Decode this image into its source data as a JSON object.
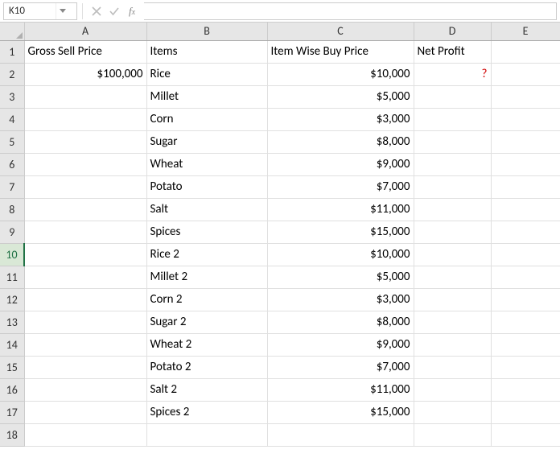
{
  "namebox": {
    "value": "K10"
  },
  "formula": {
    "value": ""
  },
  "columns": [
    "A",
    "B",
    "C",
    "D",
    "E"
  ],
  "active_row": 10,
  "header": {
    "A": "Gross Sell Price",
    "B": "Items",
    "C": "Item Wise Buy Price",
    "D": "Net Profit",
    "E": ""
  },
  "row2": {
    "A": "$100,000",
    "D": "?"
  },
  "rows": [
    {
      "n": 2,
      "B": "Rice",
      "C": "$10,000"
    },
    {
      "n": 3,
      "B": "Millet",
      "C": "$5,000"
    },
    {
      "n": 4,
      "B": "Corn",
      "C": "$3,000"
    },
    {
      "n": 5,
      "B": "Sugar",
      "C": "$8,000"
    },
    {
      "n": 6,
      "B": "Wheat",
      "C": "$9,000"
    },
    {
      "n": 7,
      "B": "Potato",
      "C": "$7,000"
    },
    {
      "n": 8,
      "B": "Salt",
      "C": "$11,000"
    },
    {
      "n": 9,
      "B": "Spices",
      "C": "$15,000"
    },
    {
      "n": 10,
      "B": "Rice 2",
      "C": "$10,000"
    },
    {
      "n": 11,
      "B": "Millet 2",
      "C": "$5,000"
    },
    {
      "n": 12,
      "B": "Corn 2",
      "C": "$3,000"
    },
    {
      "n": 13,
      "B": "Sugar 2",
      "C": "$8,000"
    },
    {
      "n": 14,
      "B": "Wheat 2",
      "C": "$9,000"
    },
    {
      "n": 15,
      "B": "Potato 2",
      "C": "$7,000"
    },
    {
      "n": 16,
      "B": "Salt 2",
      "C": "$11,000"
    },
    {
      "n": 17,
      "B": "Spices 2",
      "C": "$15,000"
    }
  ],
  "empty_rows": [
    18
  ]
}
